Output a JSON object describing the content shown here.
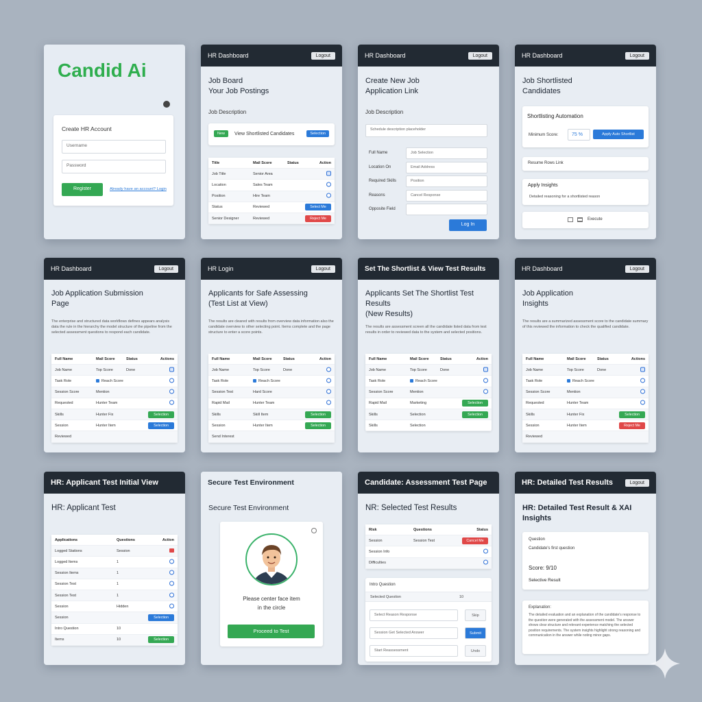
{
  "accent_colors": {
    "blue": "#2b7ad9",
    "green": "#34a853",
    "red": "#e04848",
    "header": "#222a33"
  },
  "c1": {
    "brand": "Candid Ai",
    "form_title": "Create HR Account",
    "username_ph": "Username",
    "password_ph": "Password",
    "register": "Register",
    "login_link": "Already have an account? Login"
  },
  "c2": {
    "header": "HR Dashboard",
    "logout": "Logout",
    "title1": "Job Board",
    "title2": "Your Job Postings",
    "sub": "Job Description",
    "panel_text": "View Shortlisted Candidates",
    "panel_btn_left": "New",
    "panel_btn_right": "Selection",
    "cols": [
      "Title",
      "Mail Score",
      "Status",
      "Action"
    ],
    "rows": [
      [
        "Job Title",
        "Senior Area",
        ""
      ],
      [
        "Location",
        "Sales Team",
        ""
      ],
      [
        "Position",
        "Hire Team",
        ""
      ],
      [
        "Status",
        "Reviewed",
        ""
      ],
      [
        "Senior Designer",
        "Reviewed",
        ""
      ]
    ],
    "actions": [
      "Select Me",
      "Reject Me"
    ]
  },
  "c3": {
    "header": "HR Dashboard",
    "logout": "Logout",
    "title1": "Create New Job",
    "title2": "Application Link",
    "sub": "Job Description",
    "desc_ph": "Schedule description placeholder",
    "labels": [
      "Full Name",
      "Location On",
      "Required Skills",
      "Reasons",
      "Opposite Field"
    ],
    "fields": [
      "Job Selection",
      "Email Address",
      "Position",
      "Cancel Response",
      ""
    ],
    "login": "Log In"
  },
  "c4": {
    "header": "HR Dashboard",
    "logout": "Logout",
    "title1": "Job Shortlisted",
    "title2": "Candidates",
    "panel_title": "Shortlisting Automation",
    "min_score_label": "Minimum Score:",
    "min_score": "75 %",
    "apply": "Apply Auto Shortlist",
    "row1": "Resume Rows Link",
    "row2_title": "Apply Insights",
    "row2_text": "Detailed reasoning for a shortlisted reason",
    "row3": "Execute"
  },
  "c5": {
    "header": "HR Dashboard",
    "logout": "Logout",
    "title1": "Job Application Submission",
    "title2": "Page",
    "para": "The enterprise and structured data workflows defines appears analysis data the rule in the hierarchy the model structure of the pipeline from the selected assessment questions to respond each candidate.",
    "cols": [
      "Full Name",
      "Mail Score",
      "Status",
      "Actions"
    ],
    "rows": [
      [
        "Job Name",
        "Top Score",
        "Done"
      ],
      [
        "Task Role",
        "Reach Score",
        ""
      ],
      [
        "Session Score",
        "Mention",
        ""
      ],
      [
        "Requested",
        "Hunter Team",
        ""
      ],
      [
        "Skills",
        "Hunter Fix",
        ""
      ],
      [
        "Session",
        "Hunter Item",
        ""
      ],
      [
        "Reviewed",
        "",
        ""
      ]
    ],
    "actions": [
      "Selection",
      "Selection"
    ]
  },
  "c6": {
    "header": "HR Login",
    "logout": "Logout",
    "title1": "Applicants for Safe Assessing",
    "title2": "(Test List at View)",
    "para": "The results are cleared with results from overview data information also the candidate overview to other selecting point. Items complete and the page structure to enter a score points.",
    "cols": [
      "Full Name",
      "Mail Score",
      "Status",
      "Action"
    ],
    "rows": [
      [
        "Job Name",
        "Top Score",
        "Done"
      ],
      [
        "Task Role",
        "Reach Score",
        ""
      ],
      [
        "Session Test",
        "Hard Score",
        ""
      ],
      [
        "Rapid Mail",
        "Hunter Team",
        ""
      ],
      [
        "Skills",
        "Skill Item",
        ""
      ],
      [
        "Session",
        "Hunter Item",
        ""
      ],
      [
        "Send Interest",
        "",
        ""
      ]
    ],
    "actions": [
      "Selection",
      "Selection"
    ]
  },
  "c7": {
    "header": "Set The Shortlist & View Test Results",
    "title1": "Applicants Set The Shortlist Test Results",
    "title2": "(New Results)",
    "para": "The results are assessment screen all the candidate listed data from test results in order to reviewed data to the system and selected positions.",
    "cols": [
      "Full Name",
      "Mail Score",
      "Status",
      "Action"
    ],
    "rows": [
      [
        "Job Name",
        "Top Score",
        "Done"
      ],
      [
        "Task Role",
        "Reach Score",
        ""
      ],
      [
        "Session Score",
        "Mention",
        ""
      ],
      [
        "Rapid Mail",
        "Marketing",
        ""
      ],
      [
        "Skills",
        "Selection",
        ""
      ],
      [
        "Skills",
        "Selection",
        ""
      ]
    ],
    "actions": [
      "Selection",
      "Selection"
    ]
  },
  "c8": {
    "header": "HR Dashboard",
    "logout": "Logout",
    "title1": "Job Application",
    "title2": "Insights",
    "para": "The results are a summarized assessment score to the candidate summary of this reviewed the information to check the qualified candidate.",
    "cols": [
      "Full Name",
      "Mail Score",
      "Status",
      "Actions"
    ],
    "rows": [
      [
        "Job Name",
        "Top Score",
        "Done"
      ],
      [
        "Task Role",
        "Reach Score",
        ""
      ],
      [
        "Session Score",
        "Mention",
        ""
      ],
      [
        "Requested",
        "Hunter Team",
        ""
      ],
      [
        "Skills",
        "Hunter Fix",
        ""
      ],
      [
        "Session",
        "Hunter Item",
        ""
      ],
      [
        "Reviewed",
        "",
        ""
      ]
    ],
    "actions": [
      "Selection",
      "Reject Me"
    ]
  },
  "c9": {
    "header": "HR: Applicant Test Initial View",
    "title": "HR: Applicant Test",
    "cols": [
      "Applications",
      "Questions",
      "Action"
    ],
    "rows": [
      [
        "Logged Stations",
        "Session",
        ""
      ],
      [
        "Logged Items",
        "1",
        ""
      ],
      [
        "Session Items",
        "1",
        ""
      ],
      [
        "Session Test",
        "1",
        ""
      ],
      [
        "Session Test",
        "1",
        ""
      ],
      [
        "Session",
        "Hidden",
        ""
      ],
      [
        "Session",
        "",
        ""
      ],
      [
        "Intro Question",
        "10",
        ""
      ],
      [
        "Items",
        "10",
        ""
      ]
    ],
    "actions": [
      "Selection",
      "Selection"
    ]
  },
  "c10": {
    "header": "Secure Test Environment",
    "title": "Secure Test Environment",
    "text1": "Please center face item",
    "text2": "in the circle",
    "proceed": "Proceed to Test"
  },
  "c11": {
    "header": "Candidate: Assessment Test Page",
    "title": "NR: Selected Test Results",
    "cols": [
      "Risk",
      "Questions",
      "Status"
    ],
    "rows": [
      [
        "Session",
        "Session Test",
        ""
      ],
      [
        "Session Info",
        "",
        ""
      ],
      [
        "Difficulties",
        "",
        ""
      ]
    ],
    "reject": "Cancel Me",
    "panel_title": "Intro Question",
    "panel_row": "Selected Question",
    "panel_num": "10",
    "answers": [
      "Select Reason Response",
      "Session Get Selected Answer",
      "Start Reassessment"
    ],
    "answer_btns": [
      "Skip",
      "Submit",
      "Undo"
    ]
  },
  "c12": {
    "header": "HR: Detailed Test Results",
    "logout": "Logout",
    "title1": "HR: Detailed Test Result & XAI",
    "title2": "Insights",
    "q_label": "Question",
    "q_text": "Candidate's first question",
    "score": "Score: 9/10",
    "sig": "Selective Result",
    "exp_label": "Explanation:",
    "exp": "The detailed evaluation and an explanation of the candidate's response to the question were generated with the assessment model. The answer shows clear structure and relevant experience matching the selected position requirements. The system insights highlight strong reasoning and communication in the answer while noting minor gaps."
  }
}
